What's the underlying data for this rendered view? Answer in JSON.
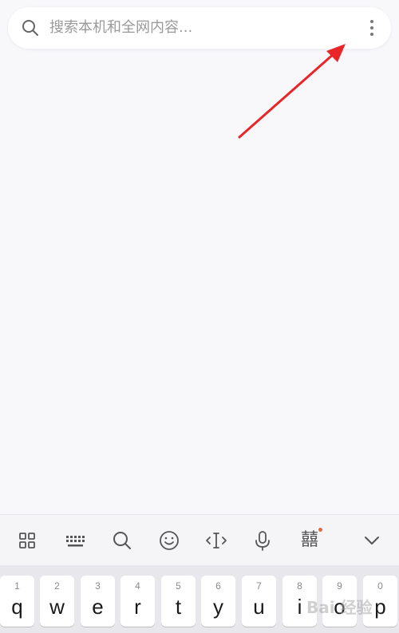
{
  "search": {
    "placeholder": "搜索本机和全网内容...",
    "icon": "search-icon",
    "more_icon": "more-vertical-icon"
  },
  "annotation": {
    "color": "#e8262a"
  },
  "toolbar": {
    "items": [
      {
        "icon": "grid-icon"
      },
      {
        "icon": "keyboard-icon"
      },
      {
        "icon": "search-icon"
      },
      {
        "icon": "emoji-icon"
      },
      {
        "icon": "cursor-icon"
      },
      {
        "icon": "microphone-icon"
      },
      {
        "icon": "skin-logo-icon",
        "glyph": "囍",
        "badge_color": "#e8663a"
      },
      {
        "icon": "chevron-down-icon"
      }
    ]
  },
  "keyboard": {
    "keys": [
      {
        "num": "1",
        "letter": "q"
      },
      {
        "num": "2",
        "letter": "w"
      },
      {
        "num": "3",
        "letter": "e"
      },
      {
        "num": "4",
        "letter": "r"
      },
      {
        "num": "5",
        "letter": "t"
      },
      {
        "num": "6",
        "letter": "y"
      },
      {
        "num": "7",
        "letter": "u"
      },
      {
        "num": "8",
        "letter": "i"
      },
      {
        "num": "9",
        "letter": "o"
      },
      {
        "num": "0",
        "letter": "p"
      }
    ]
  },
  "watermark": "Bai 经验"
}
